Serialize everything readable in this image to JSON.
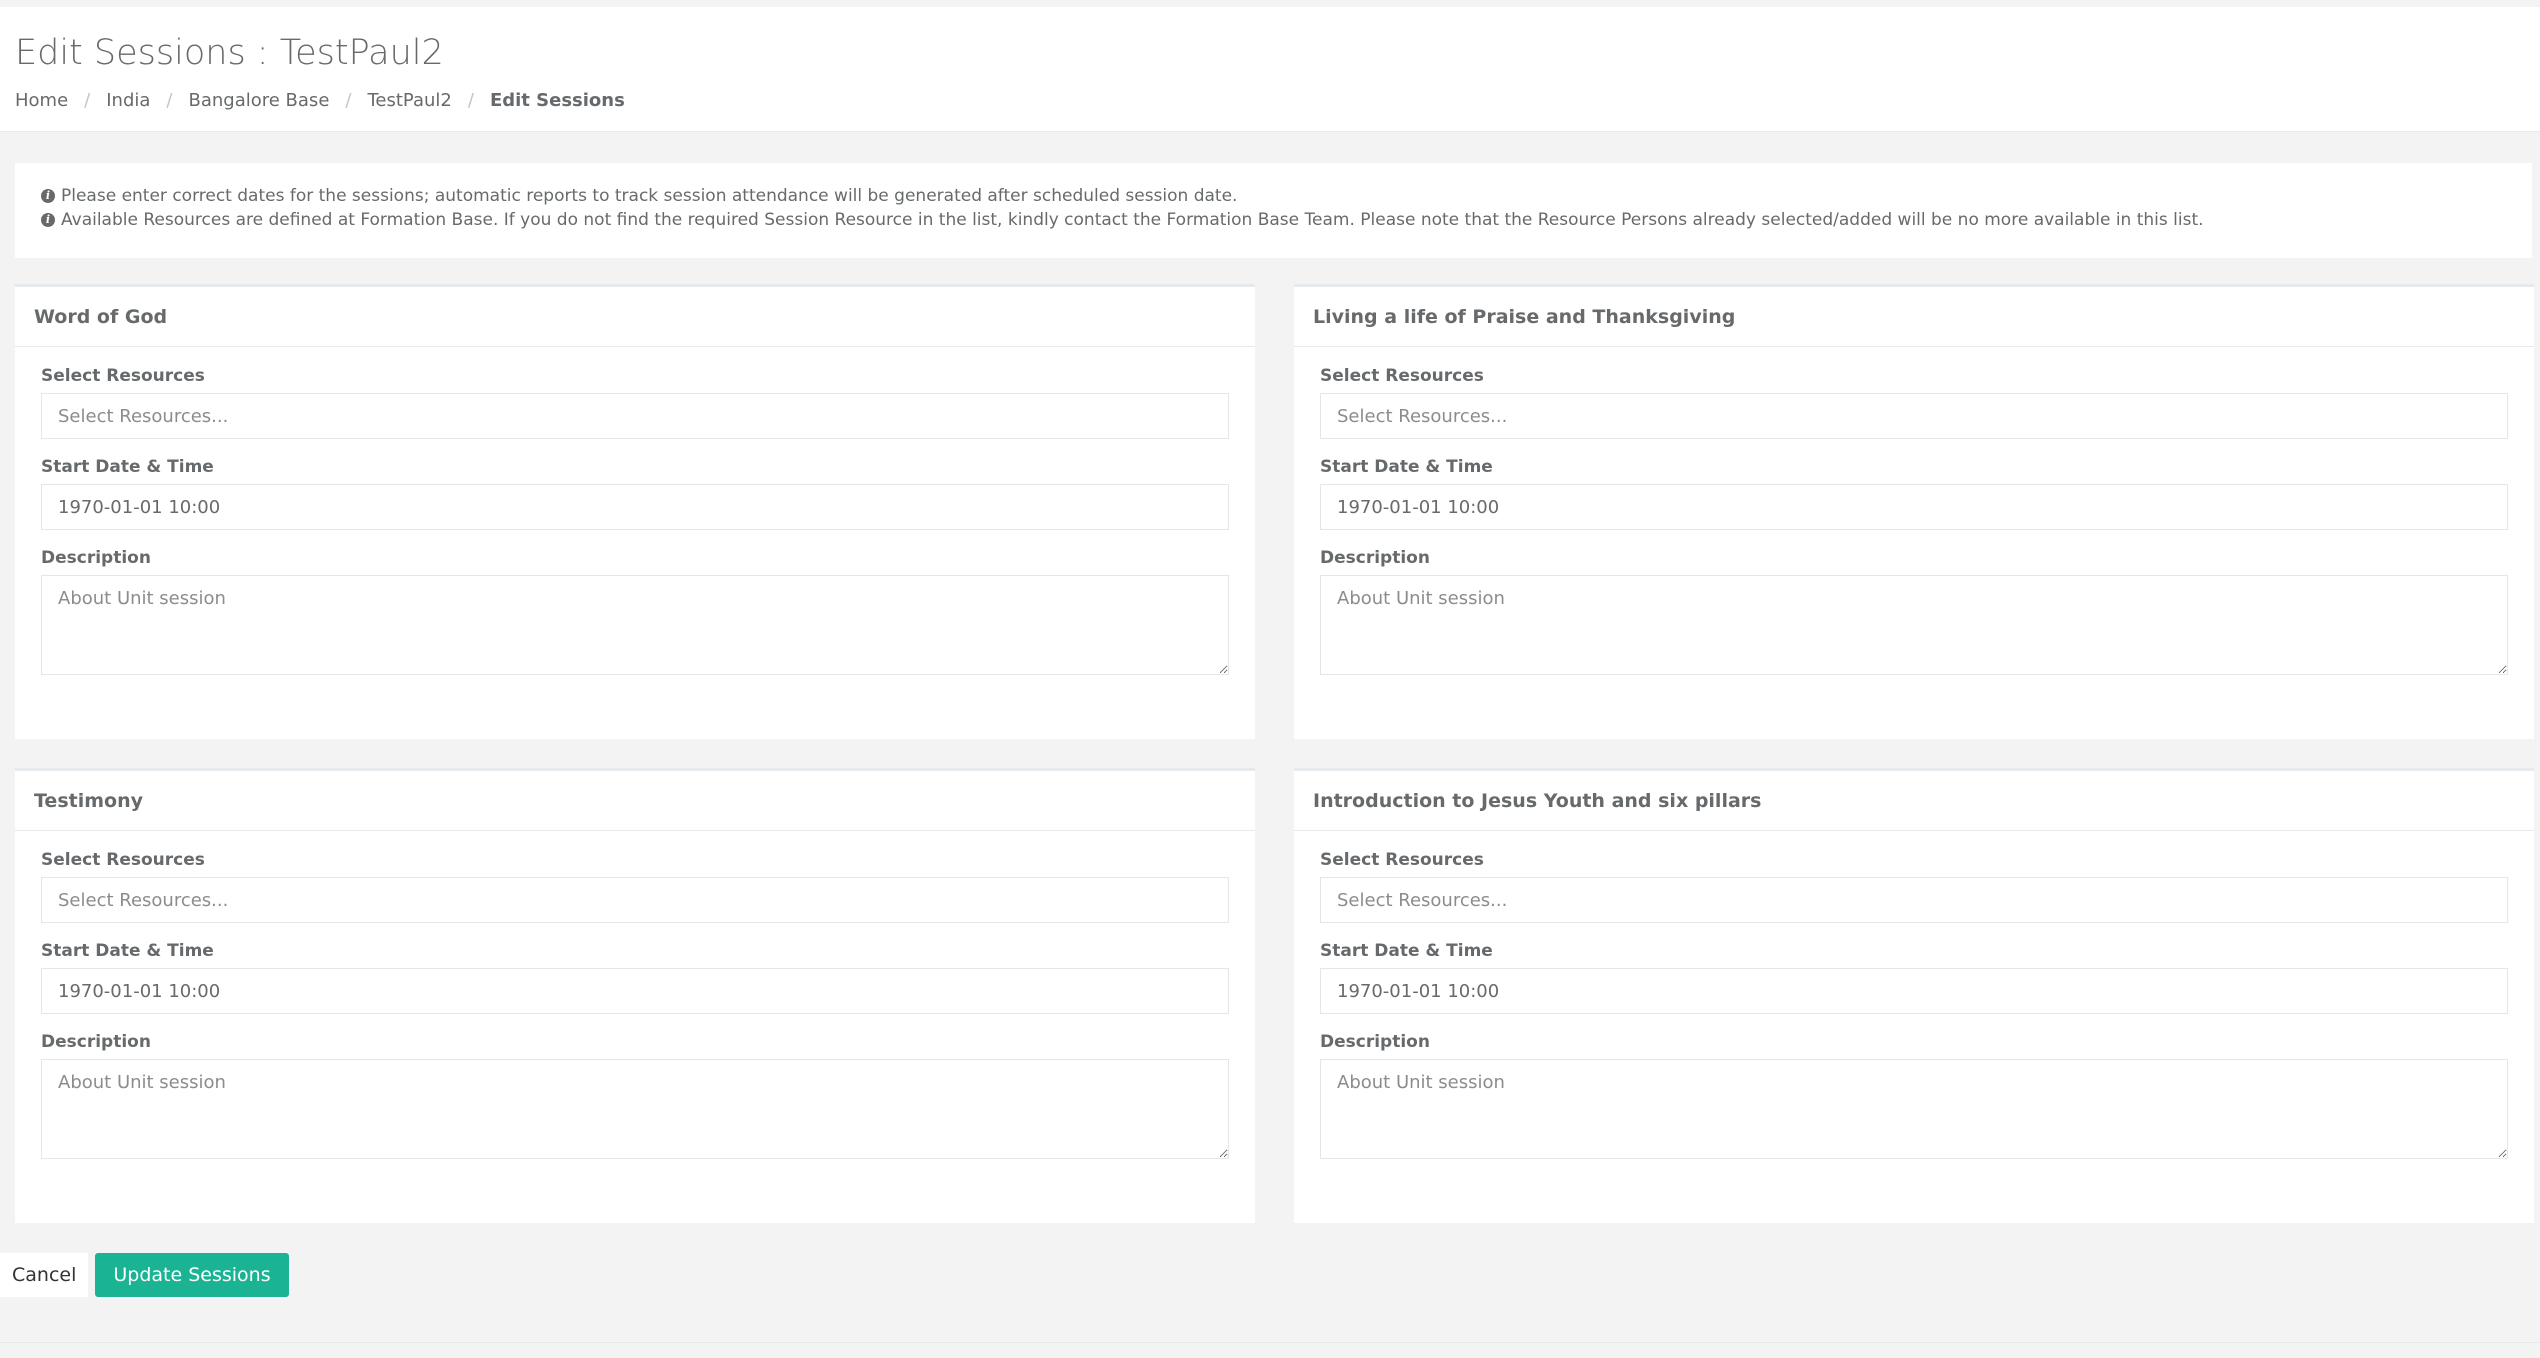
{
  "page": {
    "title": "Edit Sessions : TestPaul2"
  },
  "breadcrumb": {
    "items": [
      "Home",
      "India",
      "Bangalore Base",
      "TestPaul2"
    ],
    "separator": "/",
    "active": "Edit Sessions"
  },
  "info": {
    "icon": "info-circle-icon",
    "lines": [
      "Please enter correct dates for the sessions; automatic reports to track session attendance will be generated after scheduled session date.",
      "Available Resources are defined at Formation Base. If you do not find the required Session Resource in the list, kindly contact the Formation Base Team. Please note that the Resource Persons already selected/added will be no more available in this list."
    ]
  },
  "labels": {
    "resources": "Select Resources",
    "start": "Start Date & Time",
    "description": "Description"
  },
  "sessions": [
    {
      "title": "Word of God",
      "resources_placeholder": "Select Resources...",
      "start_value": "1970-01-01 10:00",
      "description_placeholder": "About Unit session"
    },
    {
      "title": "Living a life of Praise and Thanksgiving",
      "resources_placeholder": "Select Resources...",
      "start_value": "1970-01-01 10:00",
      "description_placeholder": "About Unit session"
    },
    {
      "title": "Testimony",
      "resources_placeholder": "Select Resources...",
      "start_value": "1970-01-01 10:00",
      "description_placeholder": "About Unit session"
    },
    {
      "title": "Introduction to Jesus Youth and six pillars",
      "resources_placeholder": "Select Resources...",
      "start_value": "1970-01-01 10:00",
      "description_placeholder": "About Unit session"
    }
  ],
  "actions": {
    "cancel": "Cancel",
    "update": "Update Sessions"
  },
  "colors": {
    "primary": "#1ab394",
    "text": "#676a6c",
    "background": "#f3f3f4",
    "border": "#e7eaec"
  }
}
